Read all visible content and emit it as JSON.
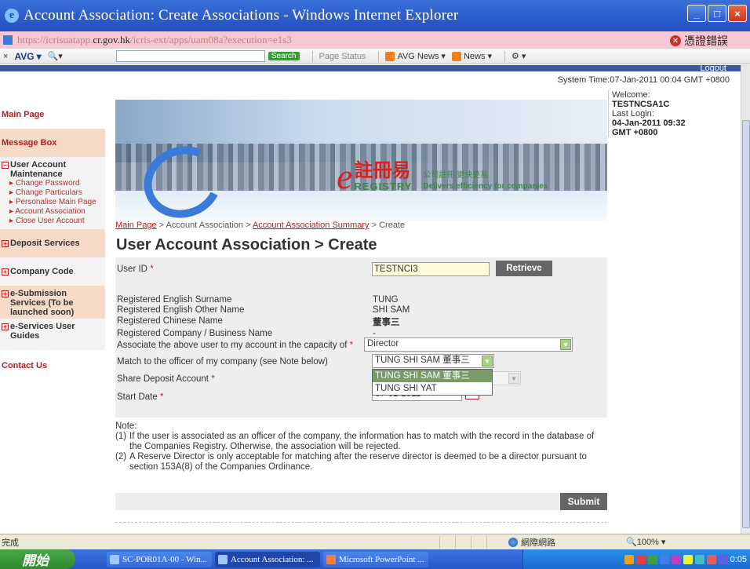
{
  "window": {
    "title": "Account Association: Create Associations - Windows Internet Explorer",
    "icon": "ie-icon"
  },
  "address": {
    "url_prefix": "https://icrisuatapp.",
    "url_host": "cr.gov.hk",
    "url_suffix": "/icris-ext/apps/uam08a?execution=e1s3",
    "cert_error": "憑證錯誤"
  },
  "toolbar": {
    "avg": "AVG",
    "search_button": "Search",
    "page_status": "Page Status",
    "avg_news": "AVG News",
    "news": "News"
  },
  "header": {
    "logout": "Logout",
    "system_time": "System Time:07-Jan-2011 00:04 GMT +0800"
  },
  "welcome": {
    "label": "Welcome:",
    "user": "TESTNCSA1C",
    "last_login_label": "Last Login:",
    "last_login_value": "04-Jan-2011 09:32",
    "tz": "GMT +0800"
  },
  "sidebar": {
    "main_page": "Main Page",
    "message_box": "Message Box",
    "user_account": {
      "title": "User Account Maintenance",
      "items": [
        "Change Password",
        "Change Particulars",
        "Personalise Main Page",
        "Account Association",
        "Close User Account"
      ]
    },
    "deposit_services": "Deposit Services",
    "company_code": "Company Code",
    "esubmission": "e-Submission Services (To be launched soon)",
    "eservices_guides": "e-Services User Guides",
    "contact_us": "Contact Us"
  },
  "banner": {
    "brand_e": "e",
    "brand_cn": "註冊易",
    "brand_en": "REGISTRY",
    "tag_cn": "公司註冊 更快更易",
    "tag_en": "Delivers efficiency for companies"
  },
  "breadcrumb": {
    "main_page": "Main Page",
    "sep": ">",
    "account_association": "Account Association",
    "summary": "Account Association Summary",
    "create": "Create"
  },
  "page_title": "User Account Association > Create",
  "form": {
    "user_id_label": "User ID",
    "user_id_value": "TESTNCI3",
    "retrieve_button": "Retrieve",
    "surname_label": "Registered English Surname",
    "surname_value": "TUNG",
    "other_name_label": "Registered English Other Name",
    "other_name_value": "SHI SAM",
    "chinese_name_label": "Registered Chinese Name",
    "chinese_name_value": "董事三",
    "company_name_label": "Registered Company / Business Name",
    "company_name_value": "-",
    "capacity_label": "Associate the above user to my account in the capacity of",
    "capacity_value": "Director",
    "match_label": "Match to the officer of my company (see Note below)",
    "match_value": "TUNG SHI SAM 董事三",
    "match_options": [
      "TUNG SHI SAM 董事三",
      "TUNG SHI YAT"
    ],
    "share_deposit_label": "Share Deposit Account",
    "start_date_label": "Start Date",
    "start_date_value": "07-01-2011",
    "required_mark": "*"
  },
  "notes": {
    "title": "Note:",
    "n1_num": "(1)",
    "n1": "If the user is associated as an officer of the company, the information has to match with the record in the database of the Companies Registry. Otherwise, the association will be rejected.",
    "n2_num": "(2)",
    "n2": "A Reserve Director is only acceptable for matching after the reserve director is deemed to be a director pursuant to section 153A(8) of the Companies Ordinance."
  },
  "submit_button": "Submit",
  "statusbar": {
    "done": "完成",
    "zone": "網際網路",
    "zoom": "100%"
  },
  "taskbar": {
    "start": "開始",
    "tasks": [
      "SC-POR01A-00 - Win...",
      "Account Association: ...",
      "Microsoft PowerPoint ..."
    ],
    "clock": "0:05"
  }
}
